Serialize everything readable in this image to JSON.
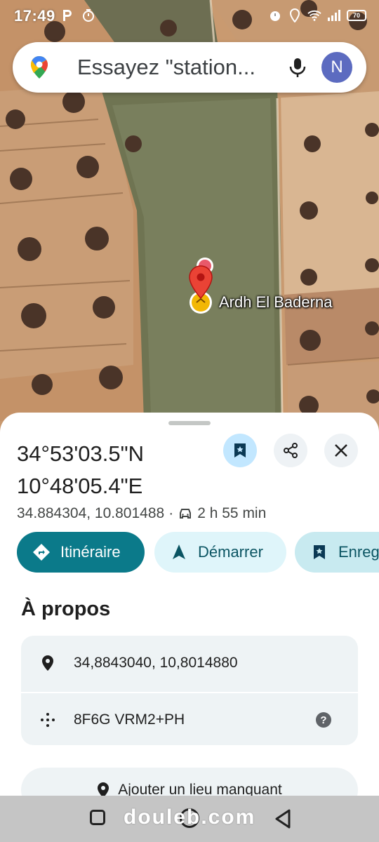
{
  "status_bar": {
    "time": "17:49",
    "left_icons": [
      "p-icon",
      "timer-icon"
    ],
    "right_icons": [
      "alarm-icon",
      "location-icon",
      "wifi-icon",
      "signal-icon"
    ],
    "battery": "70"
  },
  "search": {
    "placeholder": "Essayez \"station...",
    "avatar_letter": "N"
  },
  "map": {
    "place_label": "Ardh El Baderna"
  },
  "sheet": {
    "title_line1": "34°53'03.5\"N",
    "title_line2": "10°48'05.4\"E",
    "decimal_coords": "34.884304, 10.801488",
    "separator": "·",
    "drive_time": "2 h 55 min",
    "actions": {
      "directions": "Itinéraire",
      "start": "Démarrer",
      "save": "Enregistrer"
    },
    "about_title": "À propos",
    "info": {
      "coordinates": "34,8843040, 10,8014880",
      "plus_code": "8F6G VRM2+PH"
    },
    "add_place": "Ajouter un lieu manquant"
  },
  "nav": {
    "watermark": "douleb.com"
  },
  "colors": {
    "accent_teal": "#0b7a8a",
    "save_bubble": "#c2e7ff",
    "pin_red": "#ea4335"
  }
}
